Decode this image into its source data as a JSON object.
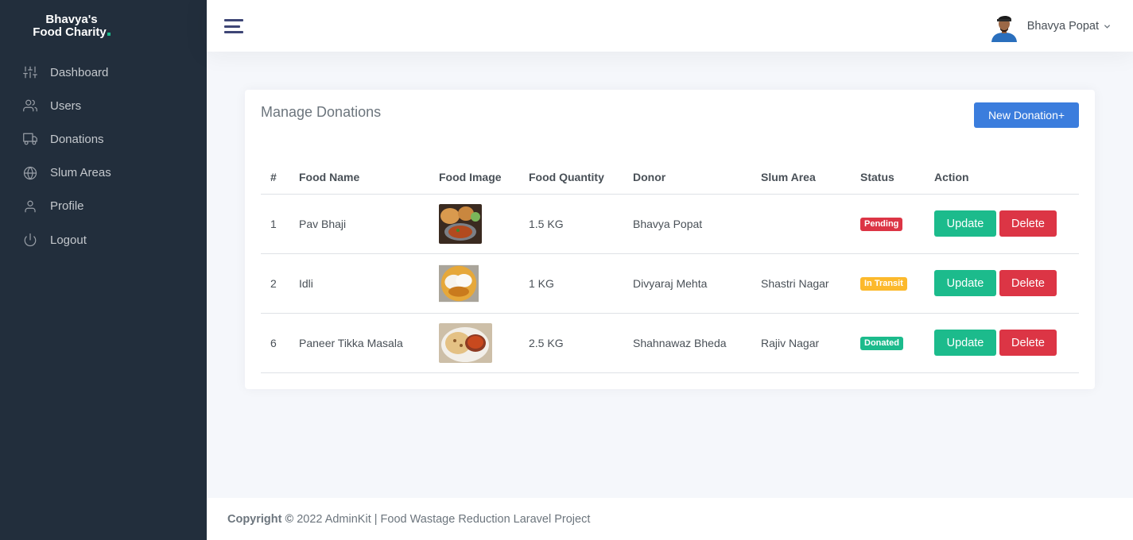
{
  "brand": {
    "line1": "Bhavya's",
    "line2": "Food Charity"
  },
  "sidebar": {
    "items": [
      {
        "label": "Dashboard",
        "icon": "sliders-icon"
      },
      {
        "label": "Users",
        "icon": "users-icon"
      },
      {
        "label": "Donations",
        "icon": "truck-icon"
      },
      {
        "label": "Slum Areas",
        "icon": "globe-icon"
      },
      {
        "label": "Profile",
        "icon": "user-icon"
      },
      {
        "label": "Logout",
        "icon": "power-icon"
      }
    ]
  },
  "topbar": {
    "user_name": "Bhavya Popat"
  },
  "card": {
    "title": "Manage Donations",
    "new_button": "New Donation+",
    "columns": [
      "#",
      "Food Name",
      "Food Image",
      "Food Quantity",
      "Donor",
      "Slum Area",
      "Status",
      "Action"
    ],
    "rows": [
      {
        "id": "1",
        "food": "Pav Bhaji",
        "quantity": "1.5 KG",
        "donor": "Bhavya Popat",
        "slum": "",
        "status": "Pending",
        "status_color": "#dc3545"
      },
      {
        "id": "2",
        "food": "Idli",
        "quantity": "1 KG",
        "donor": "Divyaraj Mehta",
        "slum": "Shastri Nagar",
        "status": "In Transit",
        "status_color": "#fcb92c"
      },
      {
        "id": "6",
        "food": "Paneer Tikka Masala",
        "quantity": "2.5 KG",
        "donor": "Shahnawaz Bheda",
        "slum": "Rajiv Nagar",
        "status": "Donated",
        "status_color": "#1cbb8c"
      }
    ],
    "update_label": "Update",
    "delete_label": "Delete"
  },
  "footer": {
    "copyright": "Copyright ©",
    "text": " 2022 AdminKit | Food Wastage Reduction Laravel Project"
  }
}
